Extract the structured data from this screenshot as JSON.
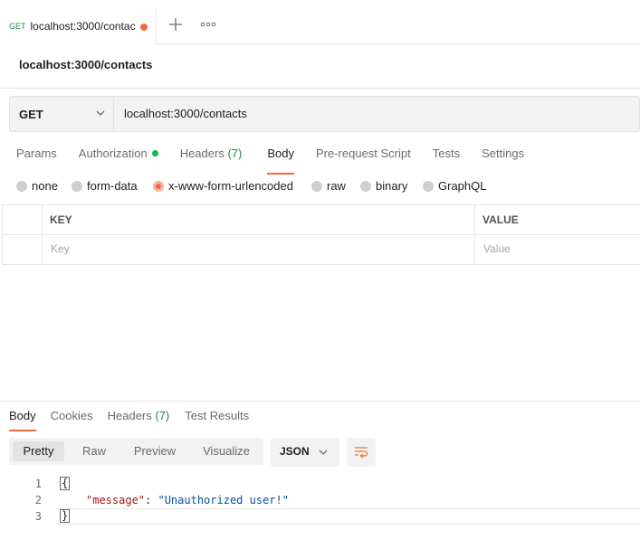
{
  "tab": {
    "method": "GET",
    "title": "localhost:3000/contac",
    "new_tab_icon": "plus-icon",
    "more_icon": "ellipsis-icon"
  },
  "request": {
    "name": "localhost:3000/contacts",
    "method": "GET",
    "url": "localhost:3000/contacts"
  },
  "request_tabs": [
    {
      "label": "Params"
    },
    {
      "label": "Authorization"
    },
    {
      "label": "Headers",
      "count": "(7)"
    },
    {
      "label": "Body"
    },
    {
      "label": "Pre-request Script"
    },
    {
      "label": "Tests"
    },
    {
      "label": "Settings"
    }
  ],
  "body_types": [
    "none",
    "form-data",
    "x-www-form-urlencoded",
    "raw",
    "binary",
    "GraphQL"
  ],
  "body_selected": "x-www-form-urlencoded",
  "kv_table": {
    "key_header": "KEY",
    "value_header": "VALUE",
    "key_placeholder": "Key",
    "value_placeholder": "Value"
  },
  "response_tabs": [
    {
      "label": "Body"
    },
    {
      "label": "Cookies"
    },
    {
      "label": "Headers",
      "count": "(7)"
    },
    {
      "label": "Test Results"
    }
  ],
  "view_modes": [
    "Pretty",
    "Raw",
    "Preview",
    "Visualize"
  ],
  "format": "JSON",
  "code": {
    "line_numbers": [
      "1",
      "2",
      "3"
    ],
    "open_brace": "{",
    "key": "\"message\"",
    "colon": ": ",
    "value": "\"Unauthorized user!\"",
    "close_brace": "}"
  },
  "colors": {
    "accent": "#f26b3a",
    "green": "#0cbb52"
  }
}
